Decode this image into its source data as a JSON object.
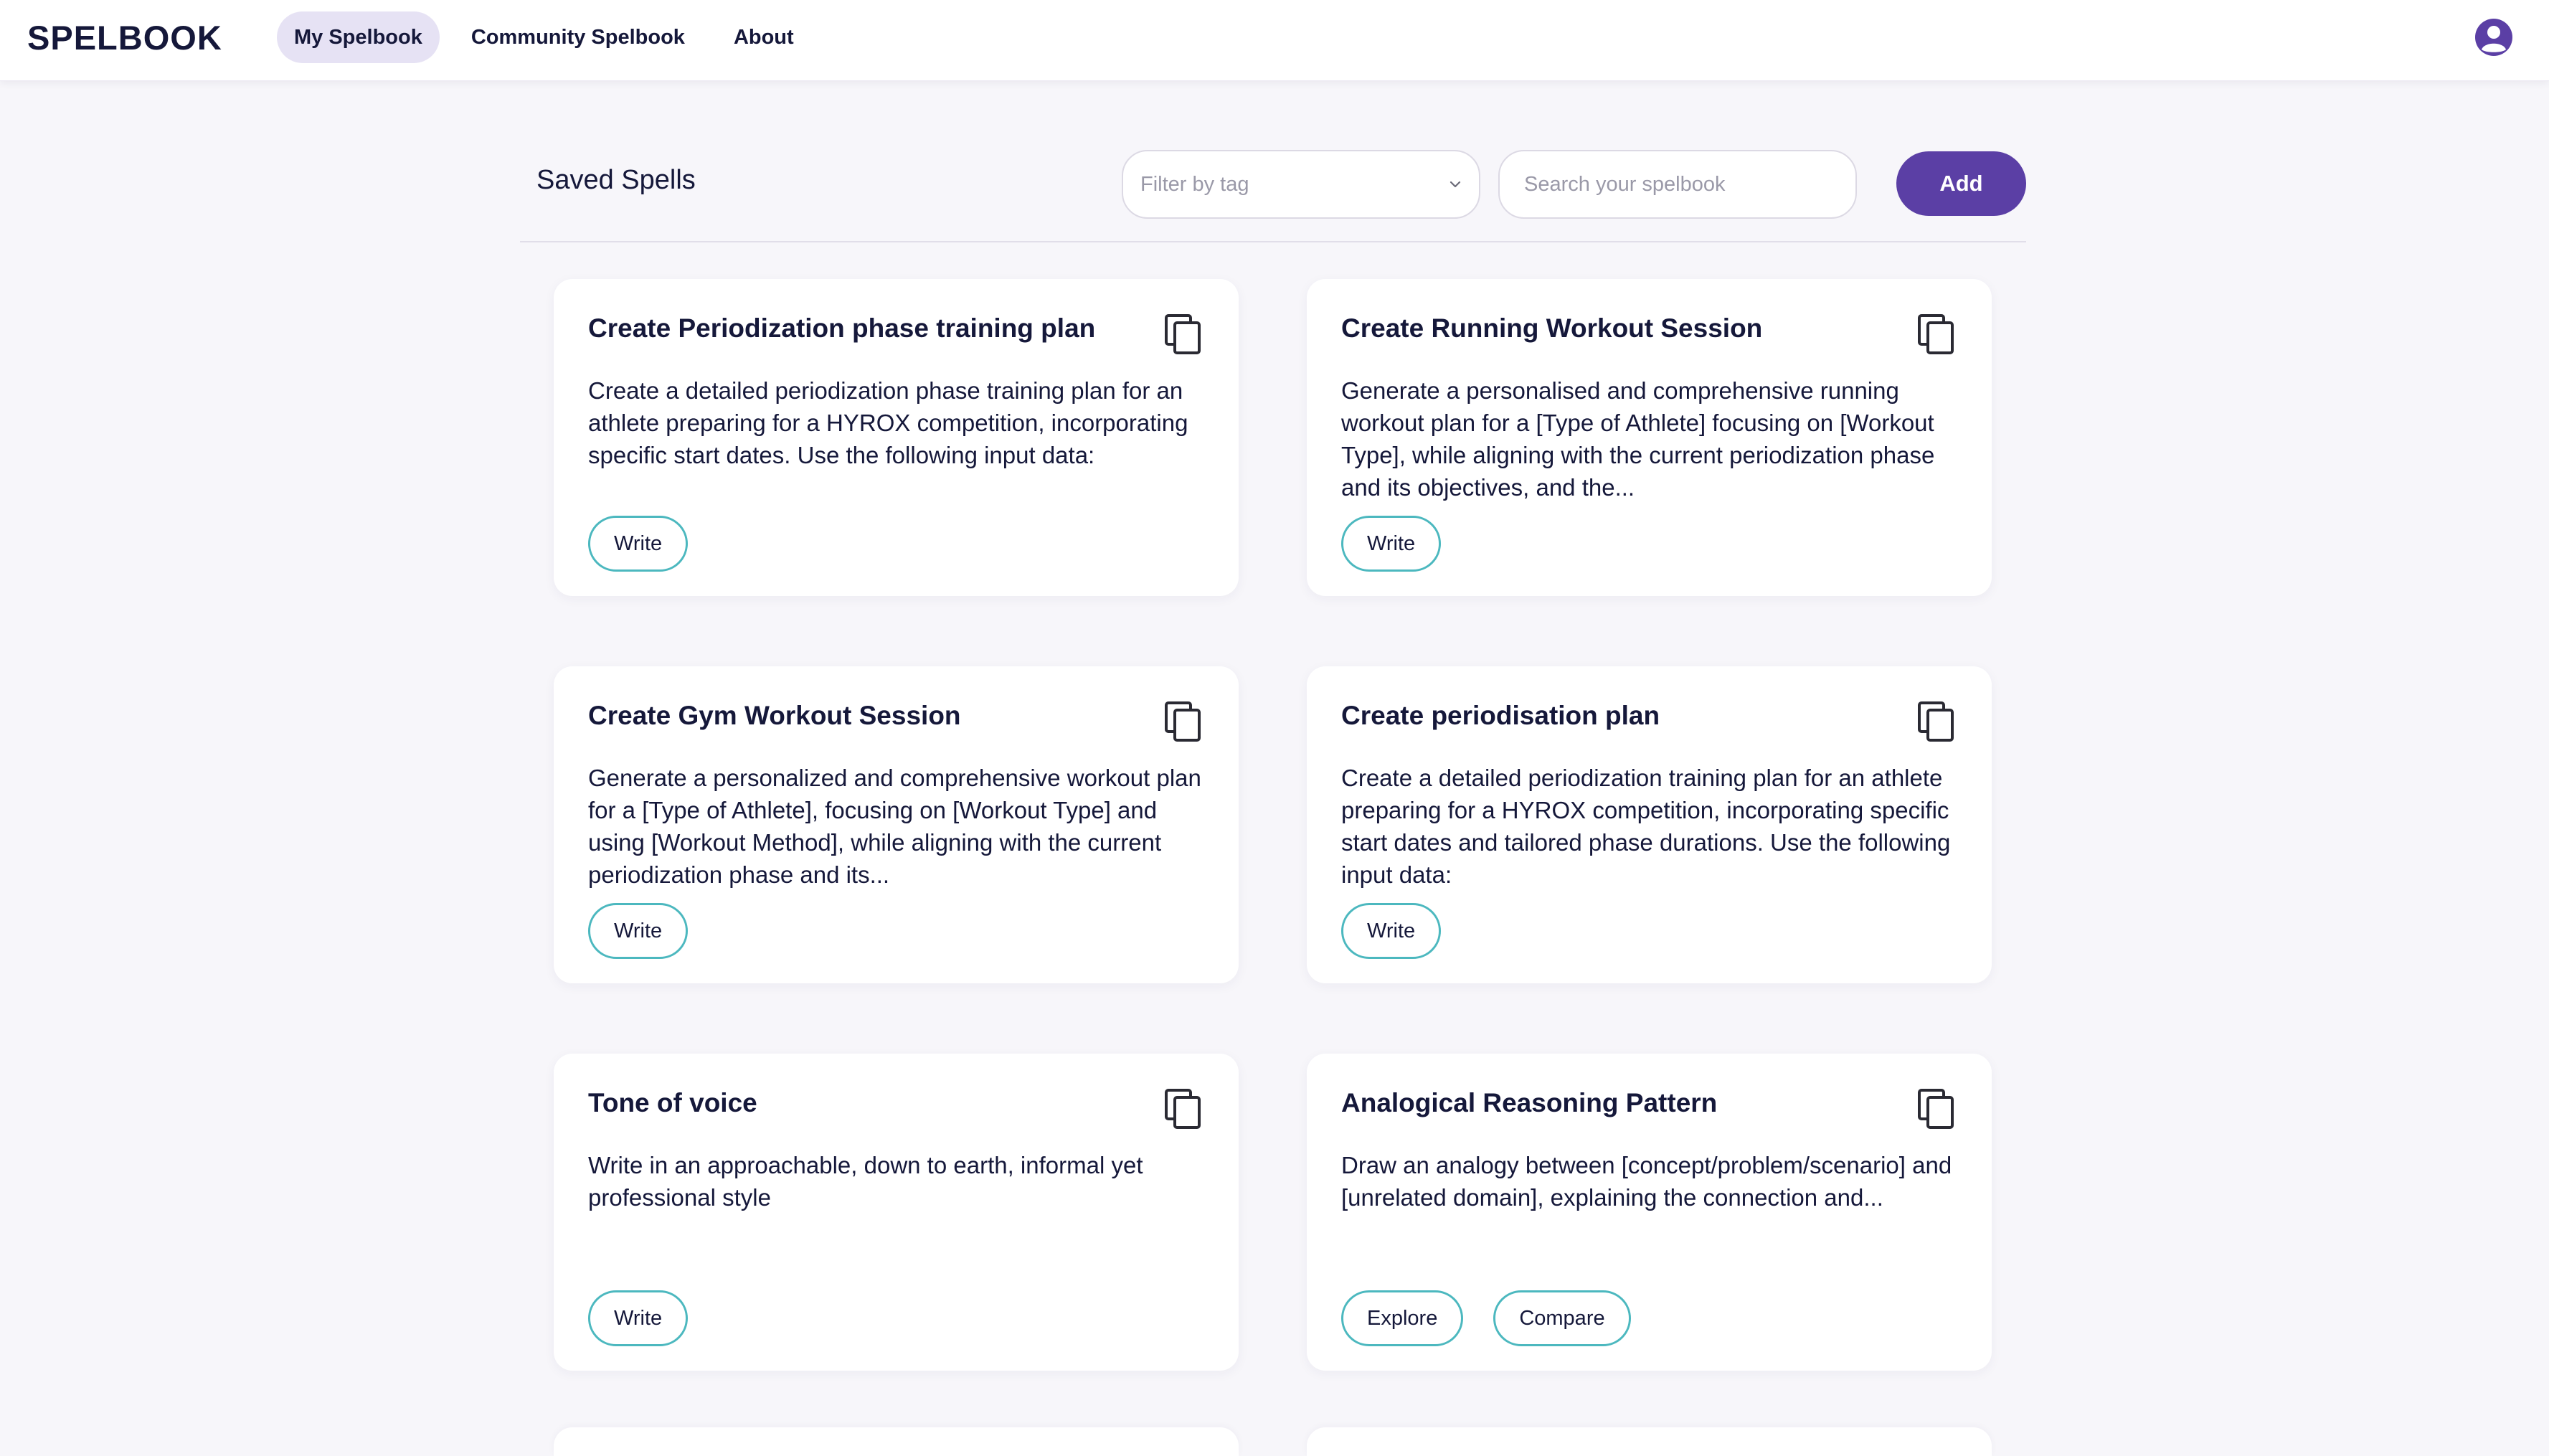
{
  "app": {
    "logo": "SPELBOOK"
  },
  "nav": {
    "items": [
      {
        "label": "My Spelbook",
        "active": true
      },
      {
        "label": "Community Spelbook",
        "active": false
      },
      {
        "label": "About",
        "active": false
      }
    ],
    "avatar_icon": "user-circle-icon"
  },
  "toolbar": {
    "title": "Saved Spells",
    "tag_filter_placeholder": "Filter by tag",
    "search_placeholder": "Search your spelbook",
    "add_label": "Add"
  },
  "colors": {
    "accent": "#5b3fa5",
    "pill_border": "#4cb8bf",
    "nav_active_bg": "#e6e2f4",
    "text": "#15183a",
    "background": "#f7f6fa"
  },
  "cards": [
    {
      "title": "Create Periodization phase training plan",
      "description": "Create a detailed periodization phase training plan for an athlete preparing for a HYROX competition, incorporating specific start dates. Use the following input data:",
      "actions": [
        "Write"
      ]
    },
    {
      "title": "Create Running Workout Session",
      "description": "Generate a personalised and comprehensive running workout plan for a [Type of Athlete] focusing on [Workout Type], while aligning with the current periodization phase and its objectives, and the...",
      "actions": [
        "Write"
      ]
    },
    {
      "title": "Create Gym Workout Session",
      "description": "Generate a personalized and comprehensive workout plan for a [Type of Athlete], focusing on [Workout Type] and using [Workout Method], while aligning with the current periodization phase and its...",
      "actions": [
        "Write"
      ]
    },
    {
      "title": "Create periodisation plan",
      "description": "Create a detailed periodization training plan for an athlete preparing for a HYROX competition, incorporating specific start dates and tailored phase durations. Use the following input data:",
      "actions": [
        "Write"
      ]
    },
    {
      "title": "Tone of voice",
      "description": "Write in an approachable, down to earth, informal yet professional style",
      "actions": [
        "Write"
      ]
    },
    {
      "title": "Analogical Reasoning Pattern",
      "description": "Draw an analogy between [concept/problem/scenario] and [unrelated domain], explaining the connection and...",
      "actions": [
        "Explore",
        "Compare"
      ]
    }
  ],
  "icons": {
    "copy": "copy-icon",
    "chevron": "chevron-down-icon"
  }
}
